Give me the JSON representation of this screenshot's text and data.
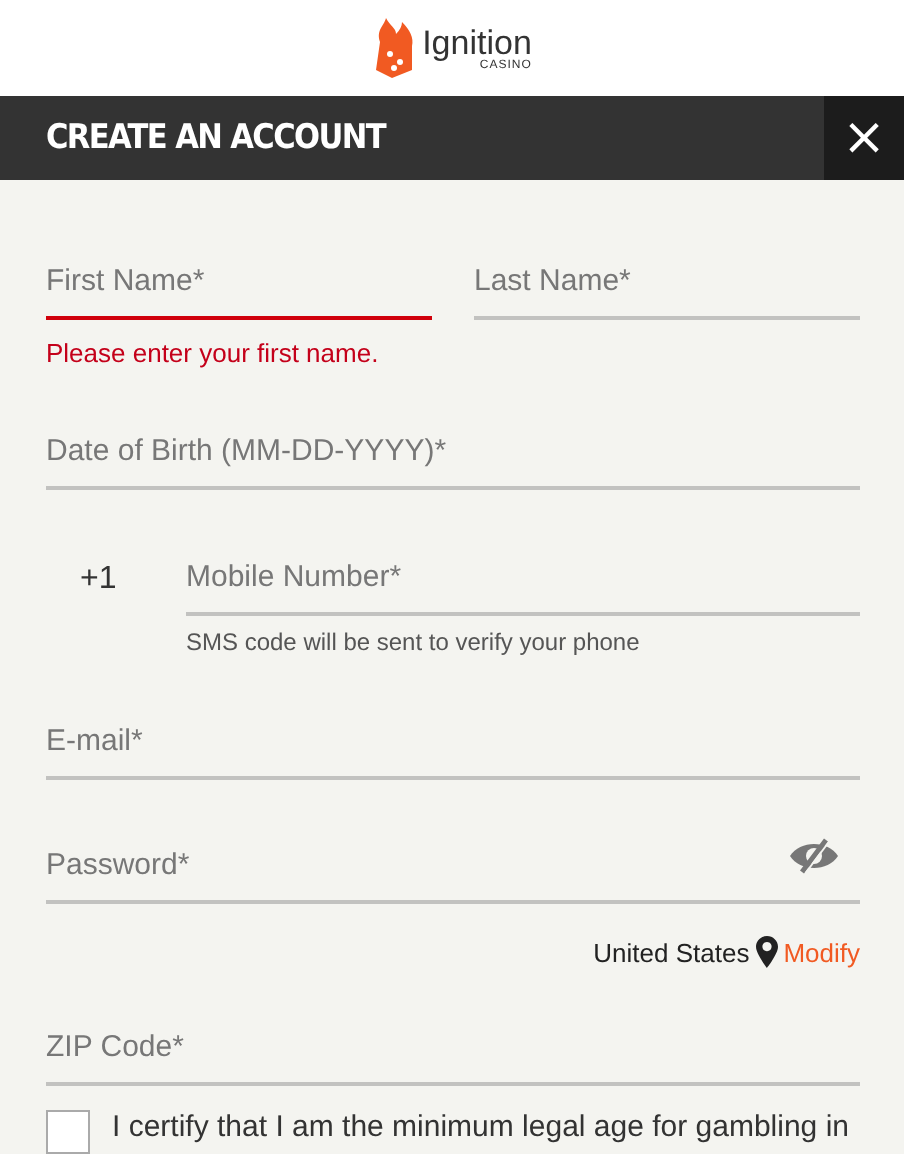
{
  "logo": {
    "name": "Ignition",
    "sub": "CASINO"
  },
  "header": {
    "title": "CREATE AN ACCOUNT",
    "close": "×"
  },
  "name_fields": [
    {
      "placeholder": "First Name*",
      "error": true
    },
    {
      "placeholder": "Last Name*",
      "error": false
    }
  ],
  "error_message": "Please enter your first name.",
  "dob": {
    "placeholder": "Date of Birth (MM-DD-YYYY)*"
  },
  "phone": {
    "prefix": "+1",
    "placeholder": "Mobile Number*",
    "hint": "SMS code will be sent to verify your phone"
  },
  "email": {
    "placeholder": "E-mail*"
  },
  "password": {
    "placeholder": "Password*",
    "visible": false
  },
  "location": {
    "country": "United States",
    "link": "Modify"
  },
  "zip": {
    "placeholder": "ZIP Code*"
  },
  "certify": {
    "checked": false,
    "text": "I certify that I am the minimum legal age for gambling in"
  }
}
